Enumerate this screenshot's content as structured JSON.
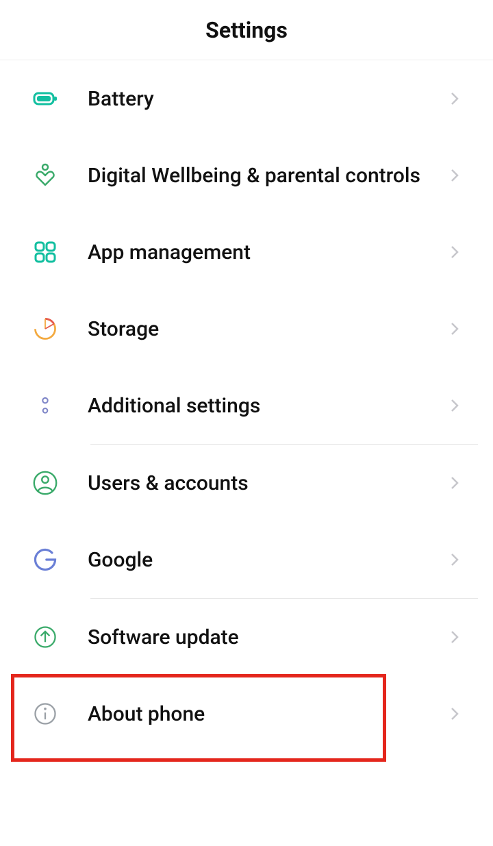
{
  "header": {
    "title": "Settings"
  },
  "items": [
    {
      "label": "Battery",
      "icon": "battery-icon"
    },
    {
      "label": "Digital Wellbeing & parental controls",
      "icon": "wellbeing-icon"
    },
    {
      "label": "App management",
      "icon": "apps-icon"
    },
    {
      "label": "Storage",
      "icon": "storage-icon"
    },
    {
      "label": "Additional settings",
      "icon": "additional-icon"
    },
    {
      "label": "Users & accounts",
      "icon": "users-icon"
    },
    {
      "label": "Google",
      "icon": "google-icon"
    },
    {
      "label": "Software update",
      "icon": "update-icon",
      "highlighted": true
    },
    {
      "label": "About phone",
      "icon": "info-icon"
    }
  ],
  "dividers_after_index": [
    4,
    6
  ]
}
